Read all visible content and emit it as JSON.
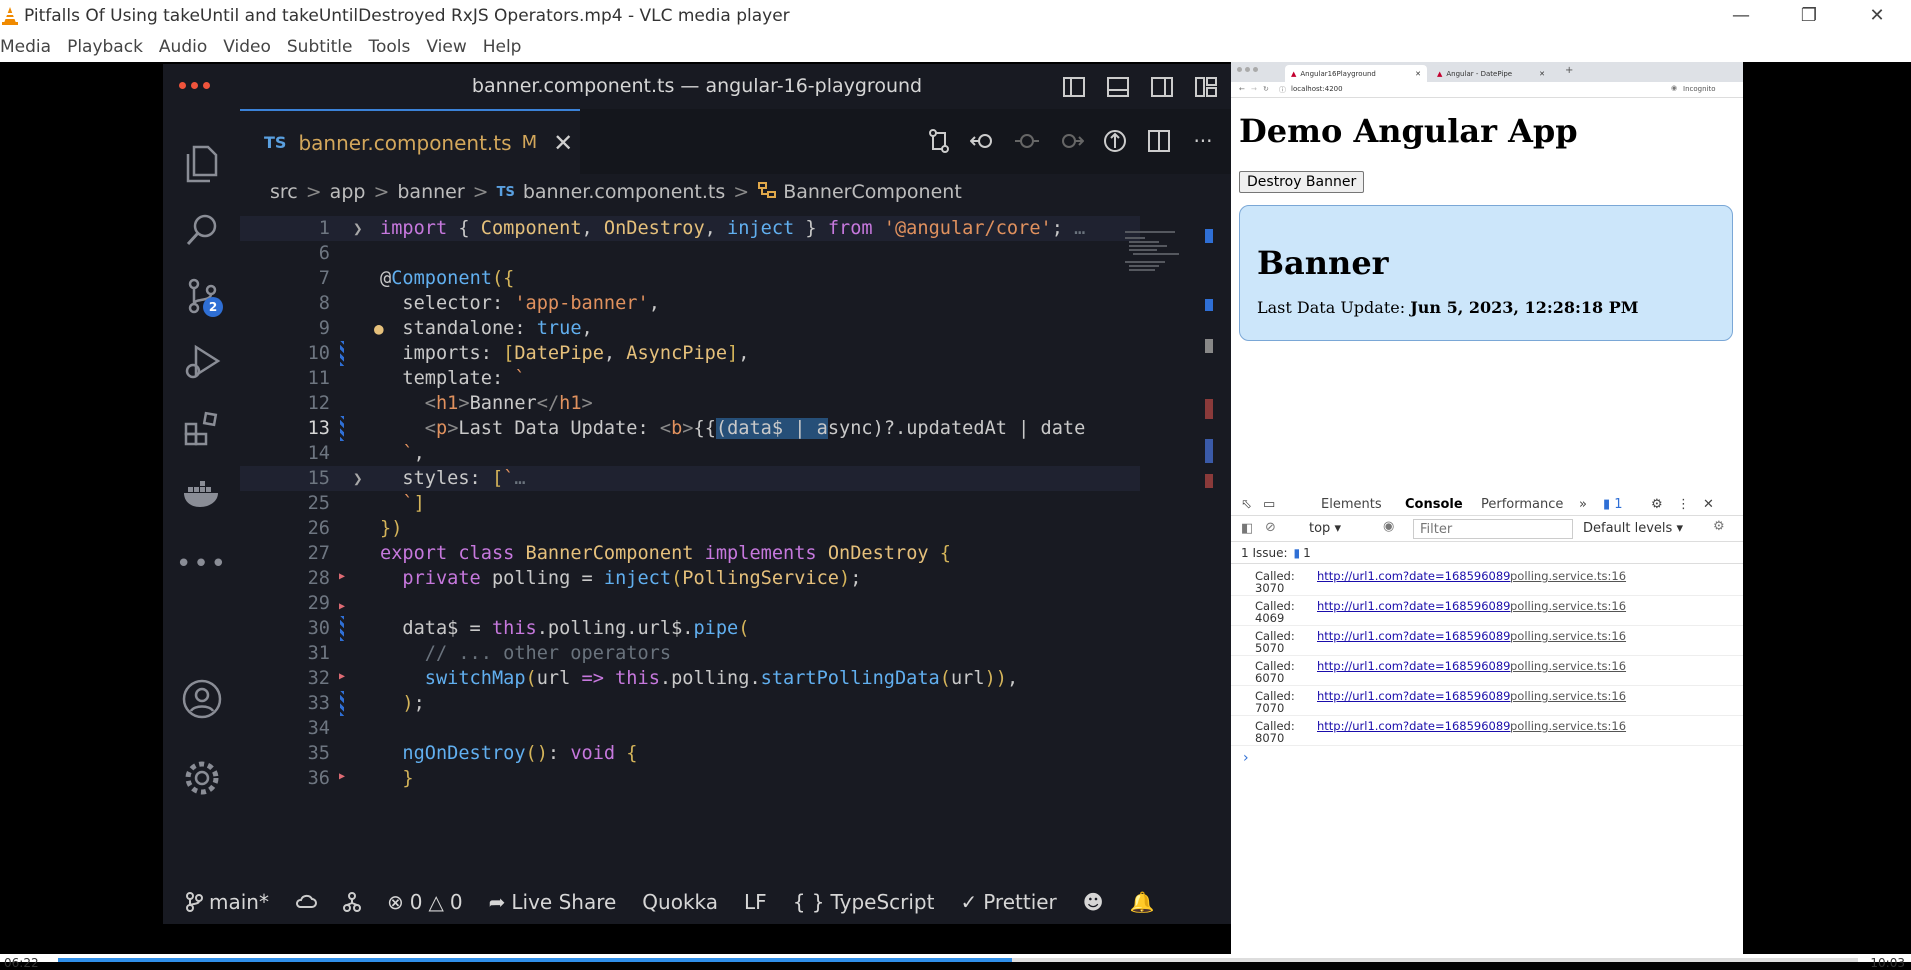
{
  "vlc": {
    "title": "Pitfalls Of Using takeUntil and takeUntilDestroyed RxJS Operators.mp4 - VLC media player",
    "menu": [
      "Media",
      "Playback",
      "Audio",
      "Video",
      "Subtitle",
      "Tools",
      "View",
      "Help"
    ],
    "time_elapsed": "06:22",
    "time_total": "10:03",
    "progress_fraction": 0.53
  },
  "vscode": {
    "window_title": "banner.component.ts — angular-16-playground",
    "tab": {
      "lang": "TS",
      "name": "banner.component.ts",
      "modified": "M"
    },
    "breadcrumb": [
      "src",
      "app",
      "banner",
      "banner.component.ts",
      "BannerComponent"
    ],
    "breadcrumb_ts": "TS",
    "scm_badge": "2",
    "line_numbers": [
      "1",
      "6",
      "7",
      "8",
      "9",
      "10",
      "11",
      "12",
      "13",
      "14",
      "15",
      "25",
      "26",
      "27",
      "28",
      "29",
      "30",
      "31",
      "32",
      "33",
      "34",
      "35",
      "36"
    ],
    "status": {
      "branch": "main*",
      "errors": "0",
      "warnings": "0",
      "live_share": "Live Share",
      "quokka": "Quokka",
      "eol": "LF",
      "language": "TypeScript",
      "prettier": "Prettier"
    }
  },
  "browser": {
    "tabs": [
      "Angular16Playground",
      "Angular - DatePipe"
    ],
    "url": "localhost:4200",
    "incognito": "Incognito",
    "page": {
      "title": "Demo Angular App",
      "button": "Destroy Banner",
      "banner_heading": "Banner",
      "last_update_label": "Last Data Update:",
      "last_update_value": "Jun 5, 2023, 12:28:18 PM"
    }
  },
  "devtools": {
    "tabs": [
      "Elements",
      "Console",
      "Performance"
    ],
    "issue_count": "1",
    "context": "top",
    "filter_placeholder": "Filter",
    "levels": "Default levels",
    "issues_label": "1 Issue:",
    "issues_num": "1",
    "logs": [
      {
        "label": "Called:",
        "url": "http://url1.com?date=168596089",
        "file": "polling.service.ts:16",
        "cont": "3070"
      },
      {
        "label": "Called:",
        "url": "http://url1.com?date=168596089",
        "file": "polling.service.ts:16",
        "cont": "4069"
      },
      {
        "label": "Called:",
        "url": "http://url1.com?date=168596089",
        "file": "polling.service.ts:16",
        "cont": "5070"
      },
      {
        "label": "Called:",
        "url": "http://url1.com?date=168596089",
        "file": "polling.service.ts:16",
        "cont": "6070"
      },
      {
        "label": "Called:",
        "url": "http://url1.com?date=168596089",
        "file": "polling.service.ts:16",
        "cont": "7070"
      },
      {
        "label": "Called:",
        "url": "http://url1.com?date=168596089",
        "file": "polling.service.ts:16",
        "cont": "8070"
      }
    ]
  },
  "colors": {
    "accent": "#2f6fd5",
    "editor_bg": "#181a22",
    "banner_bg": "#cce6fa",
    "seek": "#2f8ee8"
  }
}
